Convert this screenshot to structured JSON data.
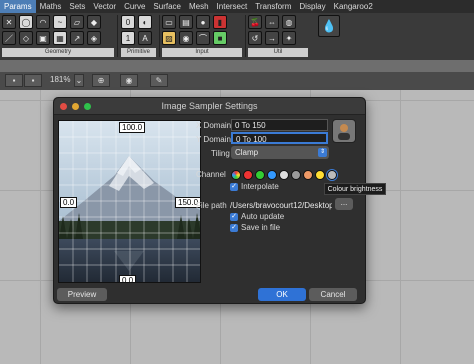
{
  "ribbon": {
    "tabs": [
      "Params",
      "Maths",
      "Sets",
      "Vector",
      "Curve",
      "Surface",
      "Mesh",
      "Intersect",
      "Transform",
      "Display",
      "Kangaroo2"
    ],
    "groups": {
      "geometry": "Geometry",
      "primitive": "Primitive",
      "input": "Input",
      "util": "Util"
    }
  },
  "toolbar": {
    "zoom": "181%"
  },
  "dialog": {
    "title": "Image Sampler Settings",
    "x_domain_label": "X Domain",
    "x_domain_value": "0 To 150",
    "y_domain_label": "Y Domain",
    "y_domain_value": "0 To 100",
    "tiling_label": "Tiling",
    "tiling_value": "Clamp",
    "channel_label": "Channel",
    "interpolate_label": "Interpolate",
    "file_path_label": "File path",
    "file_path_value": "/Users/bravocourt12/Desktop",
    "browse_label": "...",
    "auto_update_label": "Auto update",
    "save_in_file_label": "Save in file",
    "preview_button": "Preview",
    "ok_button": "OK",
    "cancel_button": "Cancel",
    "tooltip": "Colour brightness",
    "image_labels": {
      "top": "100.0",
      "left": "0.0",
      "right": "150.0",
      "bottom": "0.0"
    }
  },
  "colors": {
    "accent": "#3b7bd5",
    "ok": "#2f72d6"
  }
}
